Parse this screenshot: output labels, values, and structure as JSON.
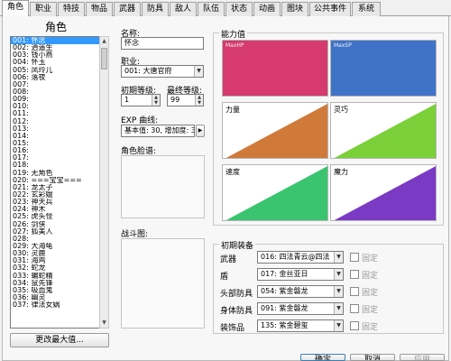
{
  "tabs": [
    {
      "label": "角色",
      "active": true
    },
    {
      "label": "职业"
    },
    {
      "label": "特技"
    },
    {
      "label": "物品"
    },
    {
      "label": "武器"
    },
    {
      "label": "防具"
    },
    {
      "label": "敌人"
    },
    {
      "label": "队伍"
    },
    {
      "label": "状态"
    },
    {
      "label": "动画"
    },
    {
      "label": "图块"
    },
    {
      "label": "公共事件"
    },
    {
      "label": "系统"
    }
  ],
  "role_panel": {
    "title": "角色",
    "list": [
      "001: 怀念",
      "002: 逍遥生",
      "003: 钱小燕",
      "004: 怀玉",
      "005: 凤玲儿",
      "006: 落夜",
      "007:",
      "008:",
      "009:",
      "010:",
      "011:",
      "012:",
      "013:",
      "014:",
      "015:",
      "016:",
      "017:",
      "018:",
      "019: 无角色",
      "020: ===宝宝===",
      "021: 龙太子",
      "022: 玄彩娥",
      "023: 神天兵",
      "024: 神木",
      "025: 虎头怪",
      "026: 剑侠",
      "027: 狐美人",
      "028:",
      "029: 大海龟",
      "030: 灵鹿",
      "031: 海鸡",
      "032: 蛇龙",
      "033: 蝙蛇精",
      "034: 鼠先锋",
      "035: 吸血鬼",
      "036: 幽灵",
      "037: 律法女娲"
    ],
    "selected_index": 0,
    "change_max_button": "更改最大值..."
  },
  "form": {
    "name_label": "名称:",
    "name_value": "怀念",
    "class_label": "职业:",
    "class_value": "001: 大唐官府",
    "initial_level_label": "初期等级:",
    "initial_level_value": "1",
    "max_level_label": "最终等级:",
    "max_level_value": "99",
    "exp_label": "EXP 曲线:",
    "exp_value": "基本值: 30, 增加度: 30",
    "exp_button": "▶",
    "face_label": "角色脸谱:",
    "battler_label": "战斗图:"
  },
  "stats": {
    "title": "能力值",
    "cards": [
      {
        "caption": "MaxHP",
        "color": "#d63a6f",
        "solid": true
      },
      {
        "caption": "MaxSP",
        "color": "#3f73c8",
        "solid": true
      },
      {
        "caption": "力量",
        "color": "#d07a3a",
        "solid": false
      },
      {
        "caption": "灵巧",
        "color": "#7bd03a",
        "solid": false
      },
      {
        "caption": "速度",
        "color": "#3ac46f",
        "solid": false
      },
      {
        "caption": "魔力",
        "color": "#7a3ac4",
        "solid": false
      }
    ]
  },
  "equipment": {
    "title": "初期装备",
    "fixed_label": "固定",
    "rows": [
      {
        "label": "武器",
        "value": "016: 四法青云@四法"
      },
      {
        "label": "盾",
        "value": "017: 金丝亚日"
      },
      {
        "label": "头部防具",
        "value": "054: 紫金磐龙"
      },
      {
        "label": "身体防具",
        "value": "091: 紫金磐龙"
      },
      {
        "label": "装饰品",
        "value": "135: 紫金碧玺"
      }
    ]
  },
  "footer": {
    "ok": "确定",
    "cancel": "取消",
    "apply": "应用"
  }
}
